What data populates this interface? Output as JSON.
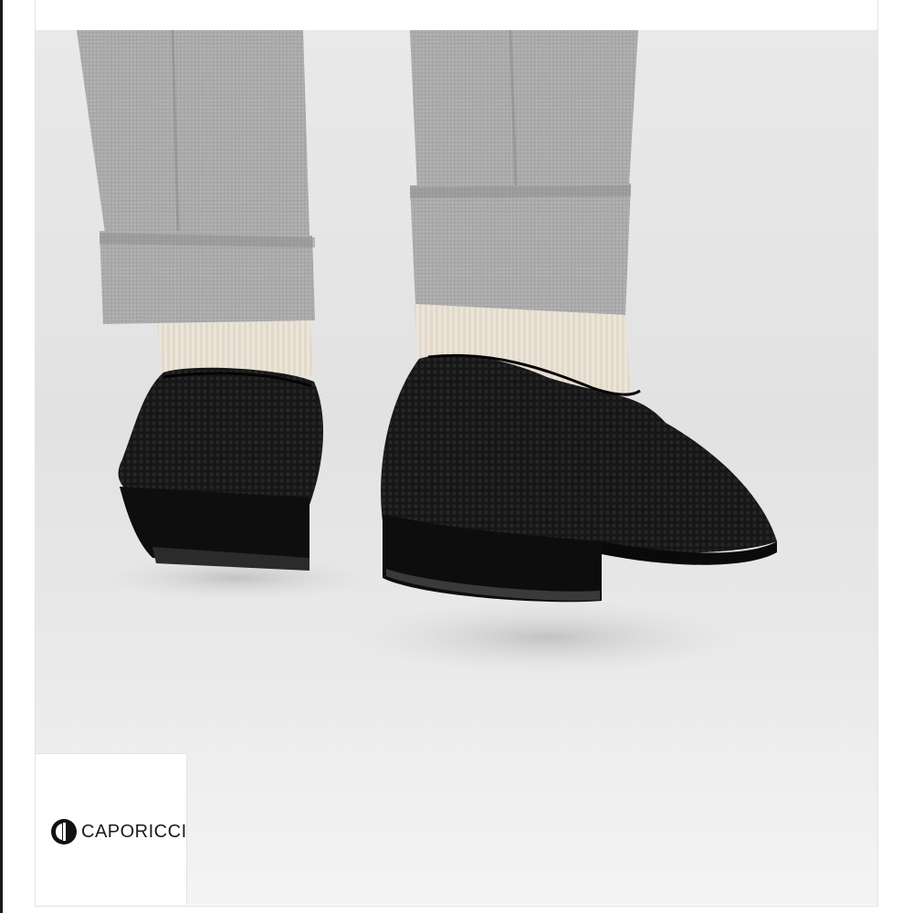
{
  "brand": {
    "name": "CAPORICCI",
    "logo_icon": "caporicci-monogram-icon"
  },
  "photo": {
    "subject": "product-photo"
  },
  "colors": {
    "background": "#ffffff",
    "photo_backdrop": "#e6e6e6",
    "trouser": "#a7a7a7",
    "sock": "#e9e2d6",
    "shoe": "#151515"
  }
}
